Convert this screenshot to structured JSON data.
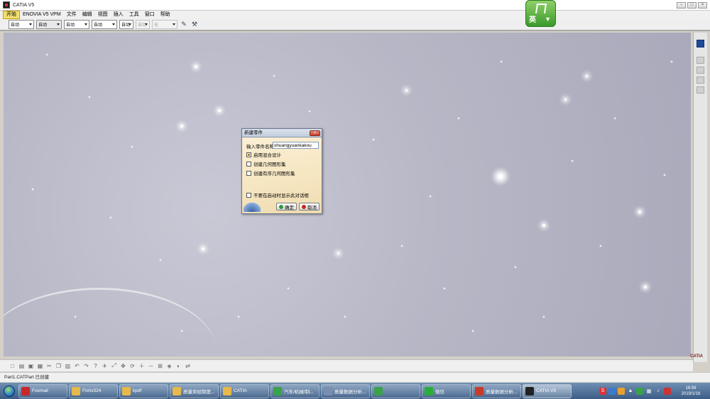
{
  "window": {
    "title": "CATIA V5",
    "controls": [
      "−",
      "□",
      "×"
    ]
  },
  "menubar": {
    "items": [
      "开始",
      "ENOVIA V5 VPM",
      "文件",
      "编辑",
      "视图",
      "插入",
      "工具",
      "窗口",
      "帮助"
    ]
  },
  "toolbar": {
    "selects": [
      "自动",
      "自动",
      "自动",
      "自动",
      "自动",
      "自动",
      "无"
    ]
  },
  "ime": {
    "label": "英"
  },
  "dialog": {
    "title": "新建零件",
    "close": "×",
    "name_label": "输入零件名称",
    "name_value": "shuangyuankakou",
    "options": [
      {
        "label": "启用混合设计",
        "checked": true
      },
      {
        "label": "创建几何图形集",
        "checked": false
      },
      {
        "label": "创建有序几何图形集",
        "checked": false
      }
    ],
    "dont_show": {
      "label": "不要在启动时显示此对话框",
      "checked": false
    },
    "ok": "确定",
    "cancel": "取消"
  },
  "status": {
    "text": "Part1.CATPart 已创建",
    "logo": "CATIA"
  },
  "taskbar": {
    "items": [
      {
        "label": "Foxmail",
        "icon": "foxmail-icon",
        "color": "#c8282a"
      },
      {
        "label": "Fishx324",
        "icon": "folder-icon",
        "color": "#e7b84a"
      },
      {
        "label": "kpdf",
        "icon": "folder-icon",
        "color": "#e7b84a"
      },
      {
        "label": "质量奖经制度...",
        "icon": "folder-icon",
        "color": "#e7b84a"
      },
      {
        "label": "CATIA",
        "icon": "folder-icon",
        "color": "#e7b84a"
      },
      {
        "label": "汽车/机械/制...",
        "icon": "browser-icon",
        "color": "#3aa24a"
      },
      {
        "label": "质量数据分析...",
        "icon": "document-icon",
        "color": "#7a8fb0"
      },
      {
        "label": "",
        "icon": "app-icon",
        "color": "#3aa24a"
      },
      {
        "label": "微信",
        "icon": "wechat-icon",
        "color": "#2aae3a"
      },
      {
        "label": "质量数据分析...",
        "icon": "pdf-icon",
        "color": "#c83a2a"
      },
      {
        "label": "CATIA V5",
        "icon": "catia-icon",
        "color": "#222222"
      }
    ],
    "clock": {
      "time": "16:59",
      "date": "2019/1/16"
    }
  }
}
